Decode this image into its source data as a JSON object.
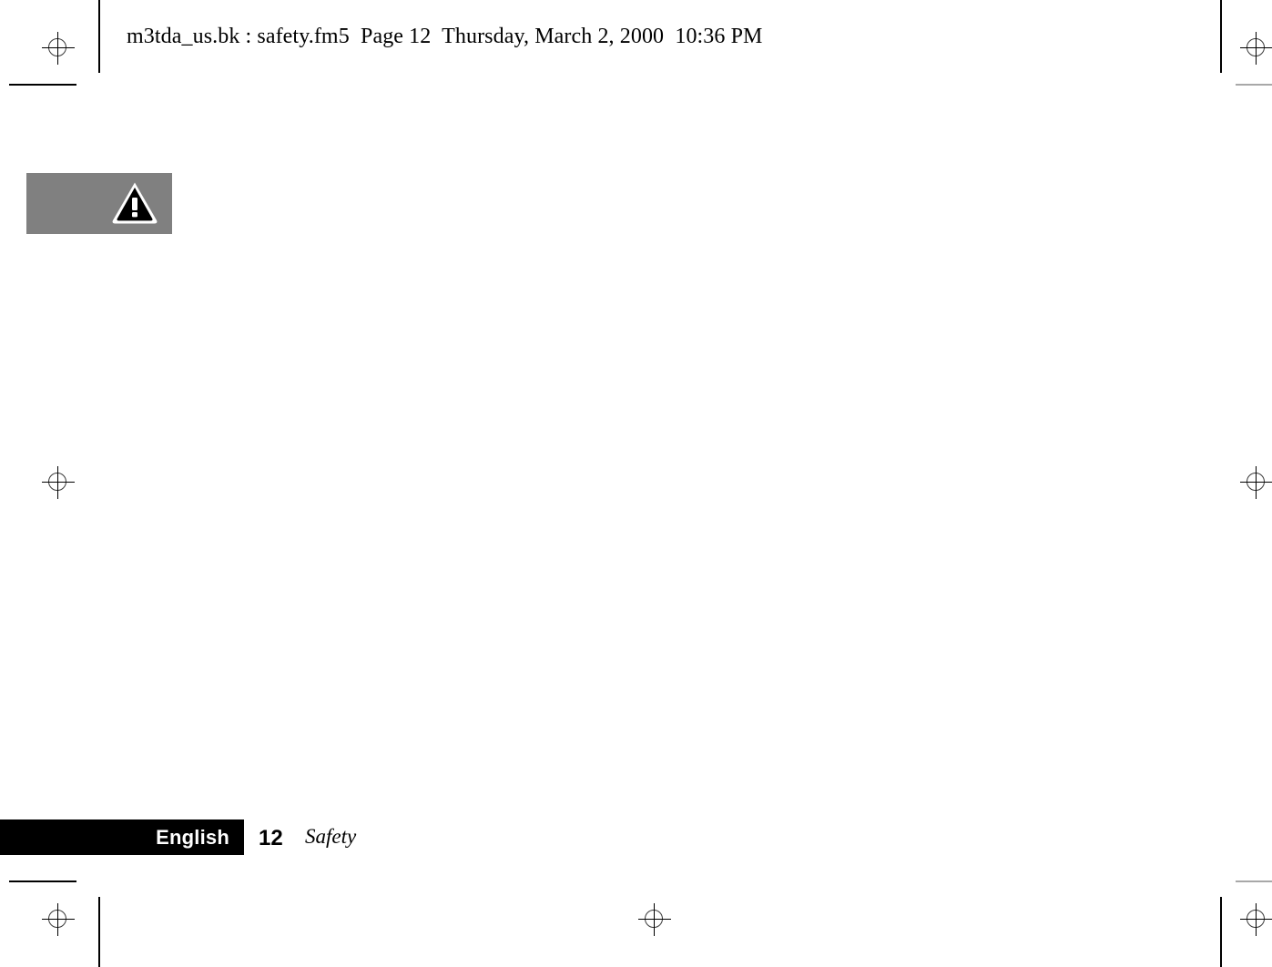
{
  "document": {
    "header_line": "m3tda_us.bk : safety.fm5  Page 12  Thursday, March 2, 2000  10:36 PM",
    "file_name": "m3tda_us.bk",
    "chapter_file": "safety.fm5",
    "page_label": "Page 12",
    "timestamp": "Thursday, March 2, 2000  10:36 PM"
  },
  "callout": {
    "icon_name": "warning-triangle-icon",
    "background_color": "#808080",
    "icon_fill": "#000000",
    "icon_outline": "#ffffff"
  },
  "footer": {
    "language": "English",
    "page_number": "12",
    "section": "Safety",
    "bar_color": "#000000",
    "language_color": "#ffffff"
  },
  "print_marks": {
    "registration_mark_name": "registration-target-mark",
    "crop_mark_name": "crop-mark",
    "trim_line_name": "page-trim-line",
    "mark_color": "#000000",
    "light_mark_color": "#a8a8a8"
  }
}
